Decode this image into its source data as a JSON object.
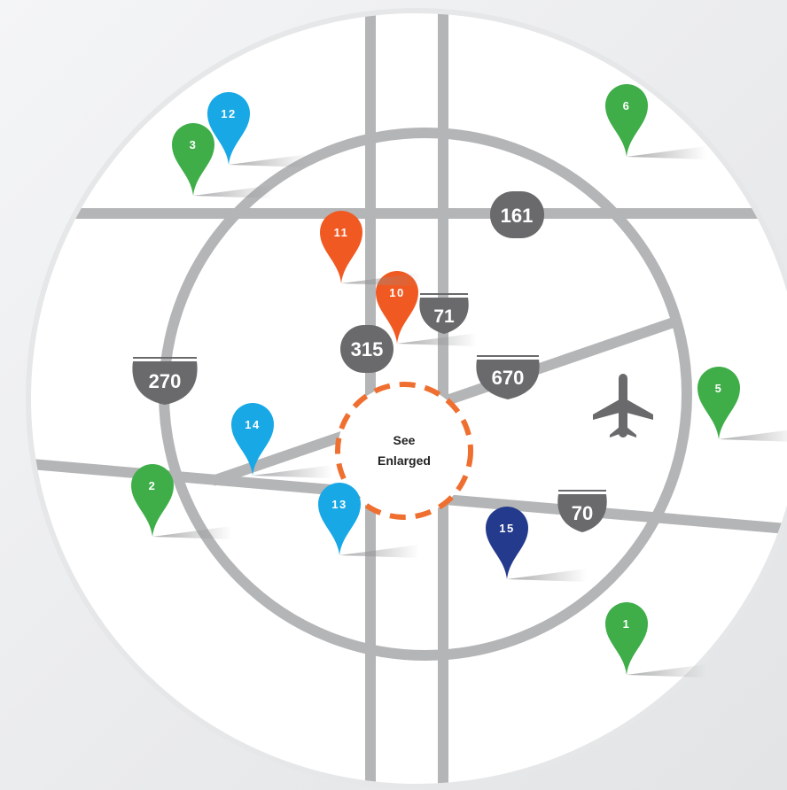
{
  "map": {
    "enlarge_label": [
      "See",
      "Enlarged"
    ],
    "airport_icon": "airplane-icon",
    "colors": {
      "background": "#eceded",
      "land": "#ffffff",
      "road": "#b4b5b7",
      "shield": "#6a6a6c",
      "enlarge_ring": "#ef6f30",
      "green_pin": "#3fae49",
      "blue_pin": "#18a8e6",
      "orange_pin": "#f05a22",
      "navy_pin": "#243a8c"
    },
    "highway_labels": [
      {
        "id": "270",
        "label": "270",
        "type": "interstate"
      },
      {
        "id": "71",
        "label": "71",
        "type": "interstate"
      },
      {
        "id": "670",
        "label": "670",
        "type": "interstate"
      },
      {
        "id": "70",
        "label": "70",
        "type": "interstate"
      },
      {
        "id": "161",
        "label": "161",
        "type": "state-route"
      },
      {
        "id": "315",
        "label": "315",
        "type": "state-route"
      }
    ],
    "pins": [
      {
        "label": "1",
        "color": "green"
      },
      {
        "label": "2",
        "color": "green"
      },
      {
        "label": "3",
        "color": "green"
      },
      {
        "label": "5",
        "color": "green"
      },
      {
        "label": "6",
        "color": "green"
      },
      {
        "label": "10",
        "color": "orange"
      },
      {
        "label": "11",
        "color": "orange"
      },
      {
        "label": "12",
        "color": "blue"
      },
      {
        "label": "13",
        "color": "blue"
      },
      {
        "label": "14",
        "color": "blue"
      },
      {
        "label": "15",
        "color": "navy"
      }
    ]
  }
}
